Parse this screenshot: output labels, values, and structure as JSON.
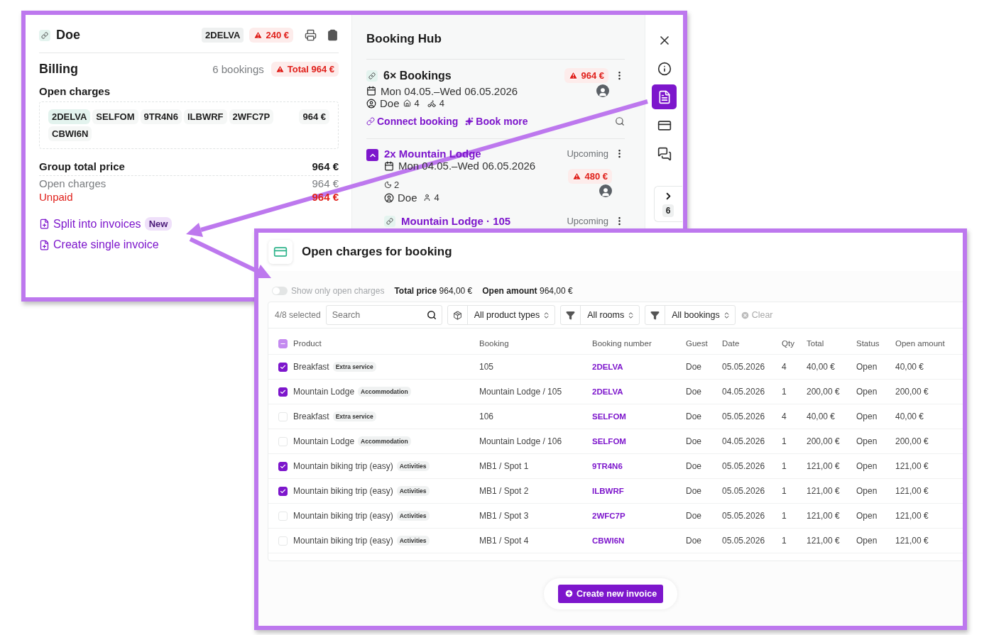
{
  "back_window": {
    "guest": {
      "name": "Doe",
      "code": "2DELVA",
      "balance": "240 €"
    },
    "billing": {
      "title": "Billing",
      "count": "6 bookings",
      "total": "Total 964 €",
      "open_title": "Open charges",
      "codes": [
        {
          "label": "2DELVA",
          "selected": true
        },
        {
          "label": "SELFOM",
          "selected": false
        },
        {
          "label": "9TR4N6",
          "selected": false
        },
        {
          "label": "ILBWRF",
          "selected": false
        },
        {
          "label": "2WFC7P",
          "selected": false
        },
        {
          "label": "CBWI6N",
          "selected": false
        }
      ],
      "codes_amount": "964 €",
      "lines": [
        {
          "kind": "total",
          "label": "Group total price",
          "value": "964 €"
        },
        {
          "kind": "muted",
          "label": "Open charges",
          "value": "964 €"
        },
        {
          "kind": "alert",
          "label": "Unpaid",
          "value": "964 €"
        }
      ],
      "actions": [
        {
          "label": "Split into invoices",
          "badge": "New"
        },
        {
          "label": "Create single invoice"
        }
      ]
    },
    "hub": {
      "title": "Booking Hub",
      "group": {
        "title": "6× Bookings",
        "amount": "964 €",
        "dates": "Mon 04.05.–Wed 06.05.2026",
        "guest": "Doe",
        "rooms": "4",
        "bikes": "4",
        "links": [
          "Connect booking",
          "Book more"
        ]
      },
      "sub": {
        "title": "2x Mountain Lodge",
        "expanded": true,
        "status": "Upcoming",
        "dates": "Mon 04.05.–Wed 06.05.2026",
        "amount": "480 €",
        "nights": "2",
        "guest": "Doe",
        "persons": "4"
      },
      "next": {
        "title": "Mountain Lodge · 105",
        "status": "Upcoming"
      }
    },
    "rail": [
      {
        "kind": "close",
        "selected": false
      },
      {
        "kind": "info",
        "selected": false
      },
      {
        "kind": "invoice",
        "selected": true
      },
      {
        "kind": "card",
        "selected": false
      },
      {
        "kind": "chat",
        "selected": false
      }
    ],
    "pager": {
      "count": "6"
    }
  },
  "front_window": {
    "title": "Open charges for booking",
    "toggle": {
      "label": "Show only open charges",
      "on": false
    },
    "summary": [
      {
        "label": "Total price",
        "value": "964,00 €"
      },
      {
        "label": "Open amount",
        "value": "964,00 €"
      }
    ],
    "selection": "4/8 selected",
    "search": {
      "placeholder": "Search"
    },
    "selects": [
      {
        "kind": "product",
        "label": "All product types"
      },
      {
        "kind": "filter",
        "label": "All rooms"
      },
      {
        "kind": "filter",
        "label": "All bookings"
      }
    ],
    "clear": "Clear",
    "table": {
      "indeterminate": true,
      "columns": [
        "Product",
        "Booking",
        "Booking number",
        "Guest",
        "Date",
        "Qty",
        "Total",
        "Status",
        "Open amount"
      ],
      "rows": [
        {
          "checked": true,
          "product": "Breakfast",
          "tag": "Extra service",
          "booking": "105",
          "number": "2DELVA",
          "guest": "Doe",
          "date": "05.05.2026",
          "qty": "4",
          "total": "40,00 €",
          "status": "Open",
          "open": "40,00 €"
        },
        {
          "checked": true,
          "product": "Mountain Lodge",
          "tag": "Accommodation",
          "booking": "Mountain Lodge / 105",
          "number": "2DELVA",
          "guest": "Doe",
          "date": "04.05.2026",
          "qty": "1",
          "total": "200,00 €",
          "status": "Open",
          "open": "200,00 €"
        },
        {
          "checked": false,
          "product": "Breakfast",
          "tag": "Extra service",
          "booking": "106",
          "number": "SELFOM",
          "guest": "Doe",
          "date": "05.05.2026",
          "qty": "4",
          "total": "40,00 €",
          "status": "Open",
          "open": "40,00 €"
        },
        {
          "checked": false,
          "product": "Mountain Lodge",
          "tag": "Accommodation",
          "booking": "Mountain Lodge / 106",
          "number": "SELFOM",
          "guest": "Doe",
          "date": "04.05.2026",
          "qty": "1",
          "total": "200,00 €",
          "status": "Open",
          "open": "200,00 €"
        },
        {
          "checked": true,
          "product": "Mountain biking trip (easy)",
          "tag": "Activities",
          "booking": "MB1 / Spot 1",
          "number": "9TR4N6",
          "guest": "Doe",
          "date": "05.05.2026",
          "qty": "1",
          "total": "121,00 €",
          "status": "Open",
          "open": "121,00 €"
        },
        {
          "checked": true,
          "product": "Mountain biking trip (easy)",
          "tag": "Activities",
          "booking": "MB1 / Spot 2",
          "number": "ILBWRF",
          "guest": "Doe",
          "date": "05.05.2026",
          "qty": "1",
          "total": "121,00 €",
          "status": "Open",
          "open": "121,00 €"
        },
        {
          "checked": false,
          "product": "Mountain biking trip (easy)",
          "tag": "Activities",
          "booking": "MB1 / Spot 3",
          "number": "2WFC7P",
          "guest": "Doe",
          "date": "05.05.2026",
          "qty": "1",
          "total": "121,00 €",
          "status": "Open",
          "open": "121,00 €"
        },
        {
          "checked": false,
          "product": "Mountain biking trip (easy)",
          "tag": "Activities",
          "booking": "MB1 / Spot 4",
          "number": "CBWI6N",
          "guest": "Doe",
          "date": "05.05.2026",
          "qty": "1",
          "total": "121,00 €",
          "status": "Open",
          "open": "121,00 €"
        }
      ]
    },
    "button": "Create new invoice"
  }
}
